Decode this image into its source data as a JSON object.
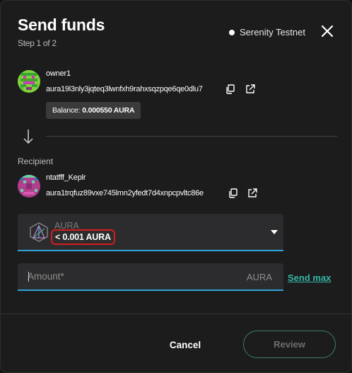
{
  "header": {
    "title": "Send funds",
    "subtitle": "Step 1 of 2",
    "network": "Serenity Testnet"
  },
  "sender": {
    "name": "owner1",
    "address": "aura19l3nly3jqteq3lwnfxh9rahxsqzpqe6qe0dlu7",
    "balance_label": "Balance:",
    "balance_value": "0.000550 AURA"
  },
  "recipient": {
    "section_label": "Recipient",
    "name": "ntatfff_Keplr",
    "address": "aura1trqfuz89vxe745lmn2yfedt7d4xnpcpvltc86e"
  },
  "token": {
    "symbol": "AURA",
    "balance": "< 0.001 AURA"
  },
  "amount": {
    "placeholder": "Amount*",
    "value": "",
    "unit": "AURA",
    "send_max_label": "Send max"
  },
  "footer": {
    "cancel_label": "Cancel",
    "review_label": "Review"
  },
  "icons": [
    "close-icon",
    "copy-icon",
    "external-link-icon",
    "arrow-down-icon",
    "aura-token-icon",
    "chevron-down-icon"
  ],
  "colors": {
    "accent_blue": "#2fa3d6",
    "send_max_teal": "#35b6a8",
    "highlight_red": "#d51d1d"
  }
}
